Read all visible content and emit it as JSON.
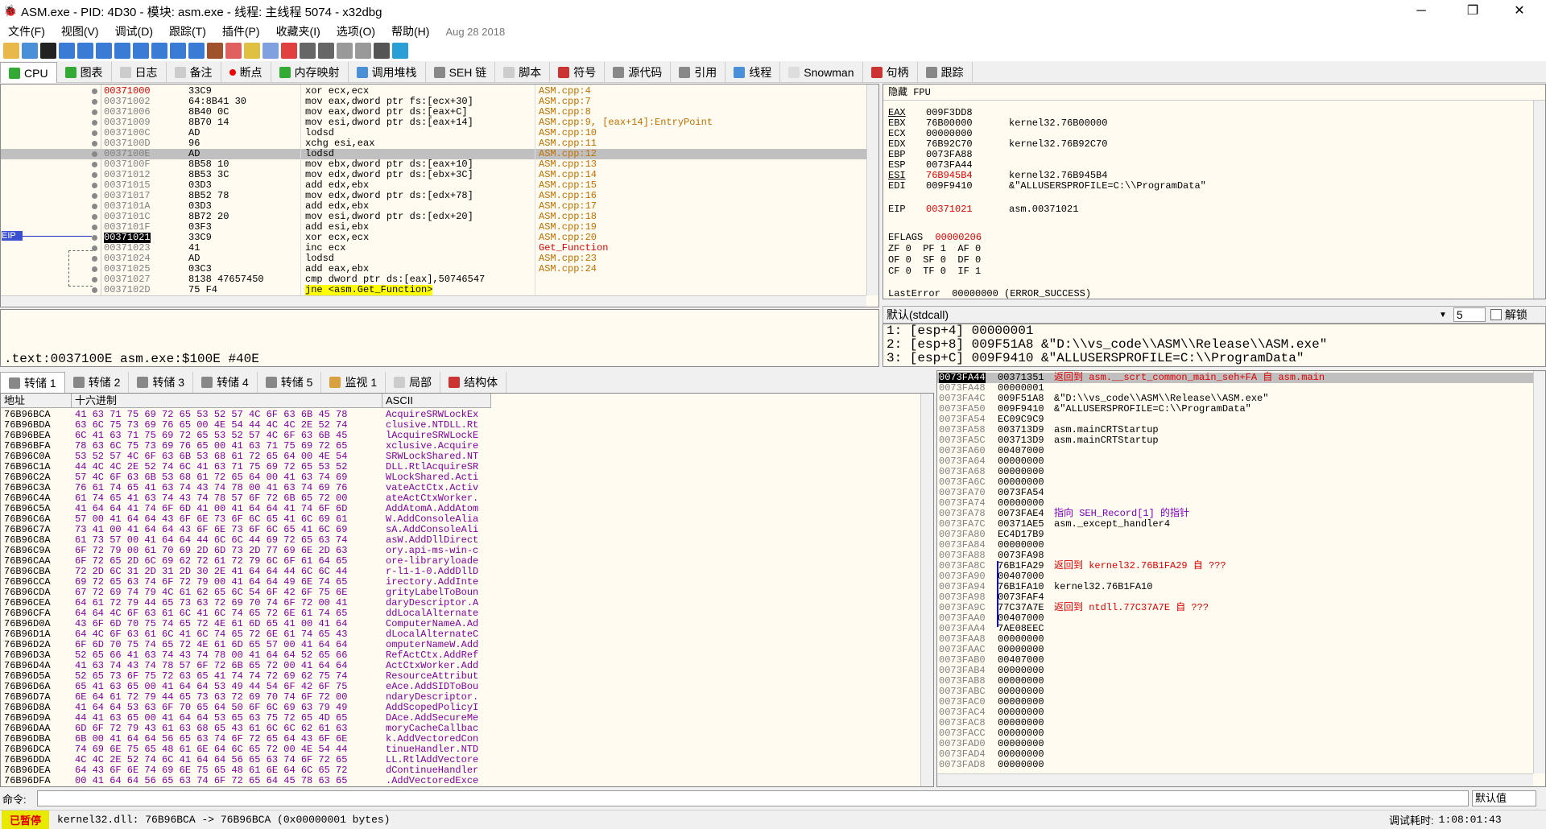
{
  "window": {
    "title": "ASM.exe - PID: 4D30 - 模块: asm.exe - 线程: 主线程 5074 - x32dbg",
    "minimize": "─",
    "maximize": "❐",
    "close": "✕"
  },
  "menu": [
    "文件(F)",
    "视图(V)",
    "调试(D)",
    "跟踪(T)",
    "插件(P)",
    "收藏夹(I)",
    "选项(O)",
    "帮助(H)"
  ],
  "build_date": "Aug 28 2018",
  "tabs": [
    "CPU",
    "图表",
    "日志",
    "备注",
    "断点",
    "内存映射",
    "调用堆栈",
    "SEH 链",
    "脚本",
    "符号",
    "源代码",
    "引用",
    "线程",
    "Snowman",
    "句柄",
    "跟踪"
  ],
  "cpu": {
    "eip_label": "EIP",
    "rows": [
      {
        "addr": "00371000",
        "bytes": "33C9",
        "asm": "xor ecx,ecx",
        "cmt": "ASM.cpp:4"
      },
      {
        "addr": "00371002",
        "bytes": "64:8B41 30",
        "asm": "mov eax,dword ptr fs:[ecx+30]",
        "cmt": "ASM.cpp:7"
      },
      {
        "addr": "00371006",
        "bytes": "8B40 0C",
        "asm": "mov eax,dword ptr ds:[eax+C]",
        "cmt": "ASM.cpp:8"
      },
      {
        "addr": "00371009",
        "bytes": "8B70 14",
        "asm": "mov esi,dword ptr ds:[eax+14]",
        "cmt": "ASM.cpp:9, [eax+14]:EntryPoint"
      },
      {
        "addr": "0037100C",
        "bytes": "AD",
        "asm": "lodsd",
        "cmt": "ASM.cpp:10"
      },
      {
        "addr": "0037100D",
        "bytes": "96",
        "asm": "xchg esi,eax",
        "cmt": "ASM.cpp:11"
      },
      {
        "addr": "0037100E",
        "bytes": "AD",
        "asm": "lodsd",
        "cmt": "ASM.cpp:12"
      },
      {
        "addr": "0037100F",
        "bytes": "8B58 10",
        "asm": "mov ebx,dword ptr ds:[eax+10]",
        "cmt": "ASM.cpp:13"
      },
      {
        "addr": "00371012",
        "bytes": "8B53 3C",
        "asm": "mov edx,dword ptr ds:[ebx+3C]",
        "cmt": "ASM.cpp:14"
      },
      {
        "addr": "00371015",
        "bytes": "03D3",
        "asm": "add edx,ebx",
        "cmt": "ASM.cpp:15"
      },
      {
        "addr": "00371017",
        "bytes": "8B52 78",
        "asm": "mov edx,dword ptr ds:[edx+78]",
        "cmt": "ASM.cpp:16"
      },
      {
        "addr": "0037101A",
        "bytes": "03D3",
        "asm": "add edx,ebx",
        "cmt": "ASM.cpp:17"
      },
      {
        "addr": "0037101C",
        "bytes": "8B72 20",
        "asm": "mov esi,dword ptr ds:[edx+20]",
        "cmt": "ASM.cpp:18"
      },
      {
        "addr": "0037101F",
        "bytes": "03F3",
        "asm": "add esi,ebx",
        "cmt": "ASM.cpp:19"
      },
      {
        "addr": "00371021",
        "bytes": "33C9",
        "asm": "xor ecx,ecx",
        "cmt": "ASM.cpp:20"
      },
      {
        "addr": "00371023",
        "bytes": "41",
        "asm": "inc ecx",
        "cmt": "Get_Function"
      },
      {
        "addr": "00371024",
        "bytes": "AD",
        "asm": "lodsd",
        "cmt": "ASM.cpp:23"
      },
      {
        "addr": "00371025",
        "bytes": "03C3",
        "asm": "add eax,ebx",
        "cmt": "ASM.cpp:24"
      },
      {
        "addr": "00371027",
        "bytes": "8138 47657450",
        "asm": "cmp dword ptr ds:[eax],50746547",
        "cmt": ""
      },
      {
        "addr": "0037102D",
        "bytes": "75 F4",
        "asm": "jne <asm.Get_Function>",
        "cmt": ""
      }
    ]
  },
  "regs": {
    "header": "隐藏 FPU",
    "lines": [
      {
        "n": "EAX",
        "v": "009F3DD8",
        "c": ""
      },
      {
        "n": "EBX",
        "v": "76B00000",
        "c": "kernel32.76B00000"
      },
      {
        "n": "ECX",
        "v": "00000000",
        "c": ""
      },
      {
        "n": "EDX",
        "v": "76B92C70",
        "c": "kernel32.76B92C70"
      },
      {
        "n": "EBP",
        "v": "0073FA88",
        "c": ""
      },
      {
        "n": "ESP",
        "v": "0073FA44",
        "c": ""
      },
      {
        "n": "ESI",
        "v": "76B945B4",
        "c": "kernel32.76B945B4"
      },
      {
        "n": "EDI",
        "v": "009F9410",
        "c": "&\"ALLUSERSPROFILE=C:\\\\ProgramData\""
      }
    ],
    "eip": {
      "n": "EIP",
      "v": "00371021",
      "c": "asm.00371021"
    },
    "eflags": {
      "n": "EFLAGS",
      "v": "00000206"
    },
    "flags": [
      "ZF 0  PF 1  AF 0",
      "OF 0  SF 0  DF 0",
      "CF 0  TF 0  IF 1"
    ],
    "lasterror": "LastError  00000000 (ERROR_SUCCESS)"
  },
  "info": ".text:0037100E asm.exe:$100E #40E",
  "callconv": {
    "label": "默认(stdcall)",
    "count": "5",
    "lock": "解锁"
  },
  "callargs": [
    "1: [esp+4] 00000001",
    "2: [esp+8] 009F51A8 &\"D:\\\\vs_code\\\\ASM\\\\Release\\\\ASM.exe\"",
    "3: [esp+C] 009F9410 &\"ALLUSERSPROFILE=C:\\\\ProgramData\""
  ],
  "dumptabs": [
    "转储 1",
    "转储 2",
    "转储 3",
    "转储 4",
    "转储 5",
    "监视 1",
    "局部",
    "结构体"
  ],
  "dumpcols": {
    "addr": "地址",
    "hex": "十六进制",
    "ascii": "ASCII"
  },
  "dump": [
    [
      "76B96BCA",
      "41 63 71 75 69 72 65 53 52 57 4C 6F 63 6B 45 78",
      "AcquireSRWLockEx"
    ],
    [
      "76B96BDA",
      "63 6C 75 73 69 76 65 00 4E 54 44 4C 4C 2E 52 74",
      "clusive.NTDLL.Rt"
    ],
    [
      "76B96BEA",
      "6C 41 63 71 75 69 72 65 53 52 57 4C 6F 63 6B 45",
      "lAcquireSRWLockE"
    ],
    [
      "76B96BFA",
      "78 63 6C 75 73 69 76 65 00 41 63 71 75 69 72 65",
      "xclusive.Acquire"
    ],
    [
      "76B96C0A",
      "53 52 57 4C 6F 63 6B 53 68 61 72 65 64 00 4E 54",
      "SRWLockShared.NT"
    ],
    [
      "76B96C1A",
      "44 4C 4C 2E 52 74 6C 41 63 71 75 69 72 65 53 52",
      "DLL.RtlAcquireSR"
    ],
    [
      "76B96C2A",
      "57 4C 6F 63 6B 53 68 61 72 65 64 00 41 63 74 69",
      "WLockShared.Acti"
    ],
    [
      "76B96C3A",
      "76 61 74 65 41 63 74 43 74 78 00 41 63 74 69 76",
      "vateActCtx.Activ"
    ],
    [
      "76B96C4A",
      "61 74 65 41 63 74 43 74 78 57 6F 72 6B 65 72 00",
      "ateActCtxWorker."
    ],
    [
      "76B96C5A",
      "41 64 64 41 74 6F 6D 41 00 41 64 64 41 74 6F 6D",
      "AddAtomA.AddAtom"
    ],
    [
      "76B96C6A",
      "57 00 41 64 64 43 6F 6E 73 6F 6C 65 41 6C 69 61",
      "W.AddConsoleAlia"
    ],
    [
      "76B96C7A",
      "73 41 00 41 64 64 43 6F 6E 73 6F 6C 65 41 6C 69",
      "sA.AddConsoleAli"
    ],
    [
      "76B96C8A",
      "61 73 57 00 41 64 64 44 6C 6C 44 69 72 65 63 74",
      "asW.AddDllDirect"
    ],
    [
      "76B96C9A",
      "6F 72 79 00 61 70 69 2D 6D 73 2D 77 69 6E 2D 63",
      "ory.api-ms-win-c"
    ],
    [
      "76B96CAA",
      "6F 72 65 2D 6C 69 62 72 61 72 79 6C 6F 61 64 65",
      "ore-libraryloade"
    ],
    [
      "76B96CBA",
      "72 2D 6C 31 2D 31 2D 30 2E 41 64 64 44 6C 6C 44",
      "r-l1-1-0.AddDllD"
    ],
    [
      "76B96CCA",
      "69 72 65 63 74 6F 72 79 00 41 64 64 49 6E 74 65",
      "irectory.AddInte"
    ],
    [
      "76B96CDA",
      "67 72 69 74 79 4C 61 62 65 6C 54 6F 42 6F 75 6E",
      "grityLabelToBoun"
    ],
    [
      "76B96CEA",
      "64 61 72 79 44 65 73 63 72 69 70 74 6F 72 00 41",
      "daryDescriptor.A"
    ],
    [
      "76B96CFA",
      "64 64 4C 6F 63 61 6C 41 6C 74 65 72 6E 61 74 65",
      "ddLocalAlternate"
    ],
    [
      "76B96D0A",
      "43 6F 6D 70 75 74 65 72 4E 61 6D 65 41 00 41 64",
      "ComputerNameA.Ad"
    ],
    [
      "76B96D1A",
      "64 4C 6F 63 61 6C 41 6C 74 65 72 6E 61 74 65 43",
      "dLocalAlternateC"
    ],
    [
      "76B96D2A",
      "6F 6D 70 75 74 65 72 4E 61 6D 65 57 00 41 64 64",
      "omputerNameW.Add"
    ],
    [
      "76B96D3A",
      "52 65 66 41 63 74 43 74 78 00 41 64 64 52 65 66",
      "RefActCtx.AddRef"
    ],
    [
      "76B96D4A",
      "41 63 74 43 74 78 57 6F 72 6B 65 72 00 41 64 64",
      "ActCtxWorker.Add"
    ],
    [
      "76B96D5A",
      "52 65 73 6F 75 72 63 65 41 74 74 72 69 62 75 74",
      "ResourceAttribut"
    ],
    [
      "76B96D6A",
      "65 41 63 65 00 41 64 64 53 49 44 54 6F 42 6F 75",
      "eAce.AddSIDToBou"
    ],
    [
      "76B96D7A",
      "6E 64 61 72 79 44 65 73 63 72 69 70 74 6F 72 00",
      "ndaryDescriptor."
    ],
    [
      "76B96D8A",
      "41 64 64 53 63 6F 70 65 64 50 6F 6C 69 63 79 49",
      "AddScopedPolicyI"
    ],
    [
      "76B96D9A",
      "44 41 63 65 00 41 64 64 53 65 63 75 72 65 4D 65",
      "DAce.AddSecureMe"
    ],
    [
      "76B96DAA",
      "6D 6F 72 79 43 61 63 68 65 43 61 6C 6C 62 61 63",
      "moryCacheCallbac"
    ],
    [
      "76B96DBA",
      "6B 00 41 64 64 56 65 63 74 6F 72 65 64 43 6F 6E",
      "k.AddVectoredCon"
    ],
    [
      "76B96DCA",
      "74 69 6E 75 65 48 61 6E 64 6C 65 72 00 4E 54 44",
      "tinueHandler.NTD"
    ],
    [
      "76B96DDA",
      "4C 4C 2E 52 74 6C 41 64 64 56 65 63 74 6F 72 65",
      "LL.RtlAddVectore"
    ],
    [
      "76B96DEA",
      "64 43 6F 6E 74 69 6E 75 65 48 61 6E 64 6C 65 72",
      "dContinueHandler"
    ],
    [
      "76B96DFA",
      "00 41 64 64 56 65 63 74 6F 72 65 64 45 78 63 65",
      ".AddVectoredExce"
    ]
  ],
  "stack": [
    [
      "0073FA44",
      "00371351",
      "返回到 asm.__scrt_common_main_seh+FA 自 asm.main",
      "r"
    ],
    [
      "0073FA48",
      "00000001",
      "",
      ""
    ],
    [
      "0073FA4C",
      "009F51A8",
      "&\"D:\\\\vs_code\\\\ASM\\\\Release\\\\ASM.exe\"",
      ""
    ],
    [
      "0073FA50",
      "009F9410",
      "&\"ALLUSERSPROFILE=C:\\\\ProgramData\"",
      ""
    ],
    [
      "0073FA54",
      "EC09C9C9",
      "",
      ""
    ],
    [
      "0073FA58",
      "003713D9",
      "asm.mainCRTStartup",
      ""
    ],
    [
      "0073FA5C",
      "003713D9",
      "asm.mainCRTStartup",
      ""
    ],
    [
      "0073FA60",
      "00407000",
      "",
      ""
    ],
    [
      "0073FA64",
      "00000000",
      "",
      ""
    ],
    [
      "0073FA68",
      "00000000",
      "",
      ""
    ],
    [
      "0073FA6C",
      "00000000",
      "",
      ""
    ],
    [
      "0073FA70",
      "0073FA54",
      "",
      ""
    ],
    [
      "0073FA74",
      "00000000",
      "",
      ""
    ],
    [
      "0073FA78",
      "0073FAE4",
      "指向 SEH_Record[1] 的指针",
      "p"
    ],
    [
      "0073FA7C",
      "00371AE5",
      "asm._except_handler4",
      ""
    ],
    [
      "0073FA80",
      "EC4D17B9",
      "",
      ""
    ],
    [
      "0073FA84",
      "00000000",
      "",
      ""
    ],
    [
      "0073FA88",
      "0073FA98",
      "",
      ""
    ],
    [
      "0073FA8C",
      "76B1FA29",
      "返回到 kernel32.76B1FA29 自 ???",
      "r"
    ],
    [
      "0073FA90",
      "00407000",
      "",
      ""
    ],
    [
      "0073FA94",
      "76B1FA10",
      "kernel32.76B1FA10",
      ""
    ],
    [
      "0073FA98",
      "0073FAF4",
      "",
      ""
    ],
    [
      "0073FA9C",
      "77C37A7E",
      "返回到 ntdll.77C37A7E 自 ???",
      "r"
    ],
    [
      "0073FAA0",
      "00407000",
      "",
      ""
    ],
    [
      "0073FAA4",
      "7AE08EEC",
      "",
      ""
    ],
    [
      "0073FAA8",
      "00000000",
      "",
      ""
    ],
    [
      "0073FAAC",
      "00000000",
      "",
      ""
    ],
    [
      "0073FAB0",
      "00407000",
      "",
      ""
    ],
    [
      "0073FAB4",
      "00000000",
      "",
      ""
    ],
    [
      "0073FAB8",
      "00000000",
      "",
      ""
    ],
    [
      "0073FABC",
      "00000000",
      "",
      ""
    ],
    [
      "0073FAC0",
      "00000000",
      "",
      ""
    ],
    [
      "0073FAC4",
      "00000000",
      "",
      ""
    ],
    [
      "0073FAC8",
      "00000000",
      "",
      ""
    ],
    [
      "0073FACC",
      "00000000",
      "",
      ""
    ],
    [
      "0073FAD0",
      "00000000",
      "",
      ""
    ],
    [
      "0073FAD4",
      "00000000",
      "",
      ""
    ],
    [
      "0073FAD8",
      "00000000",
      "",
      ""
    ]
  ],
  "cmd": {
    "label": "命令:",
    "value": "",
    "default": "默认值"
  },
  "status": {
    "paused": "已暂停",
    "msg": "kernel32.dll: 76B96BCA -> 76B96BCA (0x00000001 bytes)",
    "time_label": "调试耗时:",
    "time": "1:08:01:43"
  }
}
